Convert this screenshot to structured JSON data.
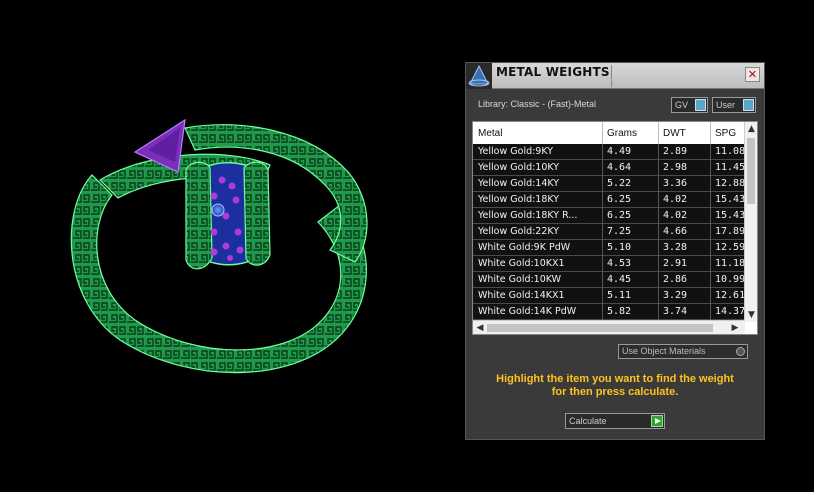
{
  "panel": {
    "title": "METAL WEIGHTS",
    "close_glyph": "✕",
    "library_label": "Library: Classic - (Fast)-Metal",
    "gv_label": "GV",
    "user_label": "User",
    "use_object_materials": "Use Object Materials",
    "hint_line1": "Highlight the item you want to find the weight",
    "hint_line2": "for then press calculate.",
    "calculate_label": "Calculate"
  },
  "table": {
    "columns": [
      "Metal",
      "Grams",
      "DWT",
      "SPG"
    ],
    "rows": [
      [
        "Yellow Gold:9KY",
        "4.49",
        "2.89",
        "11.08"
      ],
      [
        "Yellow Gold:10KY",
        "4.64",
        "2.98",
        "11.45"
      ],
      [
        "Yellow Gold:14KY",
        "5.22",
        "3.36",
        "12.88"
      ],
      [
        "Yellow Gold:18KY",
        "6.25",
        "4.02",
        "15.43"
      ],
      [
        "Yellow Gold:18KY R...",
        "6.25",
        "4.02",
        "15.43"
      ],
      [
        "Yellow Gold:22KY",
        "7.25",
        "4.66",
        "17.89"
      ],
      [
        "White Gold:9K PdW",
        "5.10",
        "3.28",
        "12.59"
      ],
      [
        "White Gold:10KX1",
        "4.53",
        "2.91",
        "11.18"
      ],
      [
        "White Gold:10KW",
        "4.45",
        "2.86",
        "10.99"
      ],
      [
        "White Gold:14KX1",
        "5.11",
        "3.29",
        "12.61"
      ],
      [
        "White Gold:14K PdW",
        "5.82",
        "3.74",
        "14.37"
      ]
    ]
  },
  "icons": {
    "logo": "pyramid-logo-icon",
    "close": "close-icon",
    "scroll_up": "chevron-up-icon",
    "scroll_down": "chevron-down-icon",
    "scroll_left": "chevron-left-icon",
    "scroll_right": "chevron-right-icon",
    "calculate": "play-icon"
  },
  "colors": {
    "ring_green": "#2fbf5c",
    "gem_purple": "#8a2fbf",
    "gem_blue": "#2a55d8",
    "hint_yellow": "#ffc21e",
    "toggle_blue": "#5aa8c8"
  }
}
